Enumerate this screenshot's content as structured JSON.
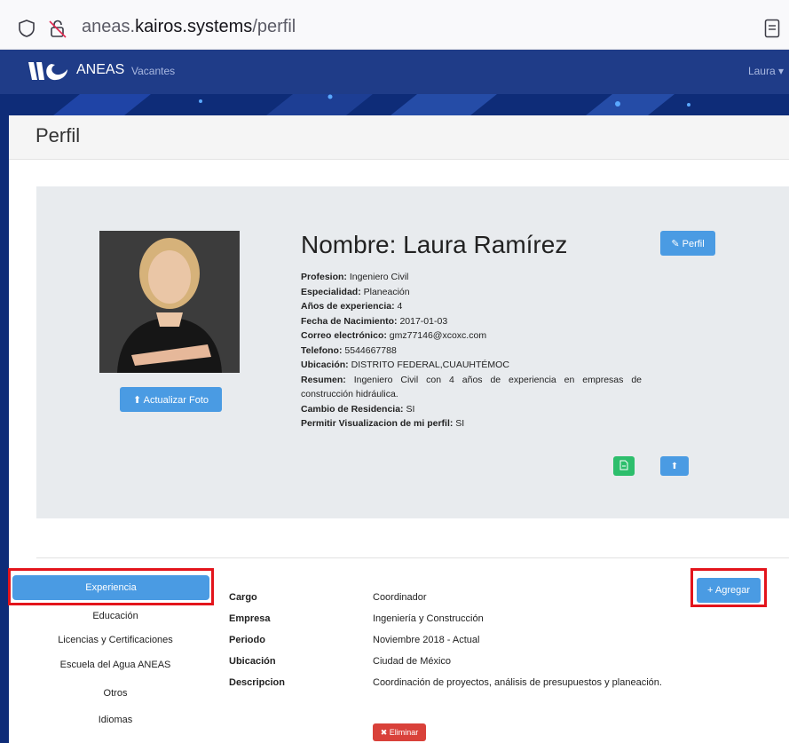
{
  "browser": {
    "url_prefix": "aneas.",
    "url_host": "kairos.systems",
    "url_path": "/perfil"
  },
  "nav": {
    "brand": "ANEAS",
    "vacantes": "Vacantes",
    "user": "Laura ▾"
  },
  "page": {
    "title": "Perfil"
  },
  "profile": {
    "name": "Nombre: Laura Ramírez",
    "perfil_button": "Perfil",
    "update_photo_button": "Actualizar Foto",
    "fields": [
      {
        "label": "Profesion:",
        "value": " Ingeniero Civil"
      },
      {
        "label": "Especialidad:",
        "value": " Planeación"
      },
      {
        "label": "Años de experiencia:",
        "value": " 4"
      },
      {
        "label": "Fecha de Nacimiento:",
        "value": " 2017-01-03"
      },
      {
        "label": "Correo electrónico:",
        "value": " gmz77146@xcoxc.com"
      },
      {
        "label": "Telefono:",
        "value": " 5544667788"
      },
      {
        "label": "Ubicación:",
        "value": " DISTRITO FEDERAL,CUAUHTÉMOC"
      },
      {
        "label": "Resumen:",
        "value": " Ingeniero Civil con 4 años de experiencia en empresas de construcción hidráulica."
      },
      {
        "label": "Cambio de Residencia:",
        "value": " SI"
      },
      {
        "label": "Permitir Visualizacion de mi perfil:",
        "value": " SI"
      }
    ]
  },
  "menu": {
    "active": "Experiencia",
    "items": [
      "Educación",
      "Licencias y Certificaciones",
      "Escuela del Agua ANEAS",
      "Otros",
      "Idiomas"
    ]
  },
  "agregar_button": "Agregar",
  "experience": {
    "rows": [
      {
        "label": "Cargo",
        "value": "Coordinador"
      },
      {
        "label": "Empresa",
        "value": "Ingeniería y Construcción"
      },
      {
        "label": "Periodo",
        "value": "Noviembre 2018 - Actual"
      },
      {
        "label": "Ubicación",
        "value": "Ciudad de México"
      },
      {
        "label": "Descripcion",
        "value": "Coordinación de proyectos, análisis de presupuestos y planeación."
      }
    ],
    "delete_button": "Eliminar"
  },
  "colors": {
    "nav": "#1f3c88",
    "primary": "#4a9be3",
    "success": "#2dbe6c",
    "danger": "#d9413a",
    "highlight": "#e3141b"
  },
  "icons": [
    "shield-icon",
    "lock-slash-icon",
    "reader-view-icon",
    "logo-icon",
    "upload-icon",
    "pencil-icon",
    "pdf-icon",
    "plus-icon",
    "close-icon"
  ]
}
